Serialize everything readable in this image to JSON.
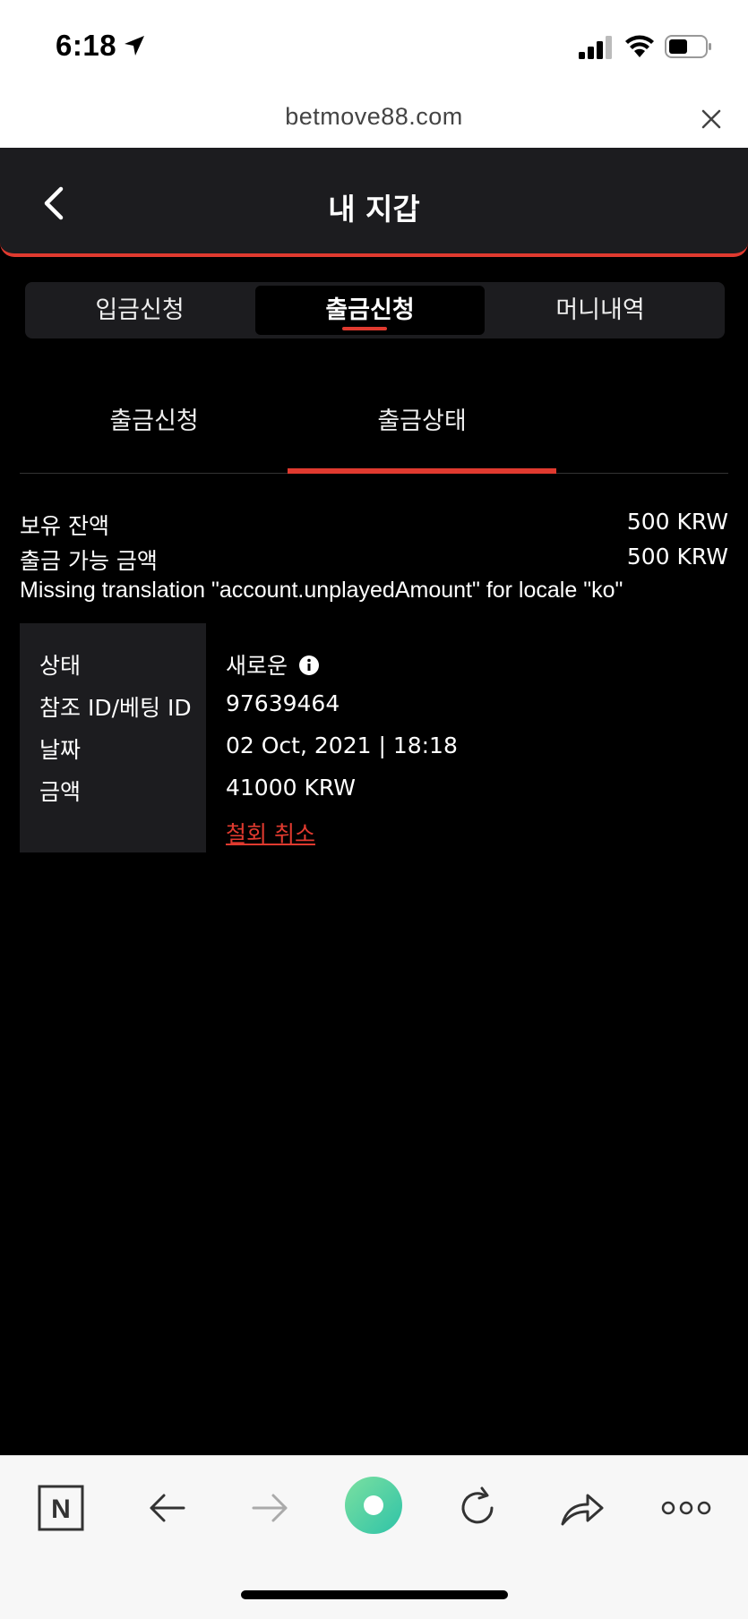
{
  "status_bar": {
    "time": "6:18"
  },
  "browser": {
    "url": "betmove88.com"
  },
  "header": {
    "title": "내 지갑"
  },
  "tabs": [
    {
      "label": "입금신청"
    },
    {
      "label": "출금신청"
    },
    {
      "label": "머니내역"
    }
  ],
  "subtabs": [
    {
      "label": "출금신청"
    },
    {
      "label": "출금상태"
    }
  ],
  "balance": {
    "held_label": "보유 잔액",
    "held_value": "500 KRW",
    "withdrawable_label": "출금 가능 금액",
    "withdrawable_value": "500 KRW",
    "missing_translation": "Missing translation \"account.unplayedAmount\" for locale \"ko\""
  },
  "details": {
    "status_label": "상태",
    "status_value": "새로운",
    "ref_label": "참조 ID/베팅 ID",
    "ref_value": "97639464",
    "date_label": "날짜",
    "date_value": "02 Oct, 2021 | 18:18",
    "amount_label": "금액",
    "amount_value": "41000 KRW",
    "cancel_label": "철회 취소"
  },
  "toolbar": {
    "n_label": "N"
  },
  "colors": {
    "accent": "#e03a2f",
    "panel": "#1c1c1f",
    "background": "#000000"
  }
}
